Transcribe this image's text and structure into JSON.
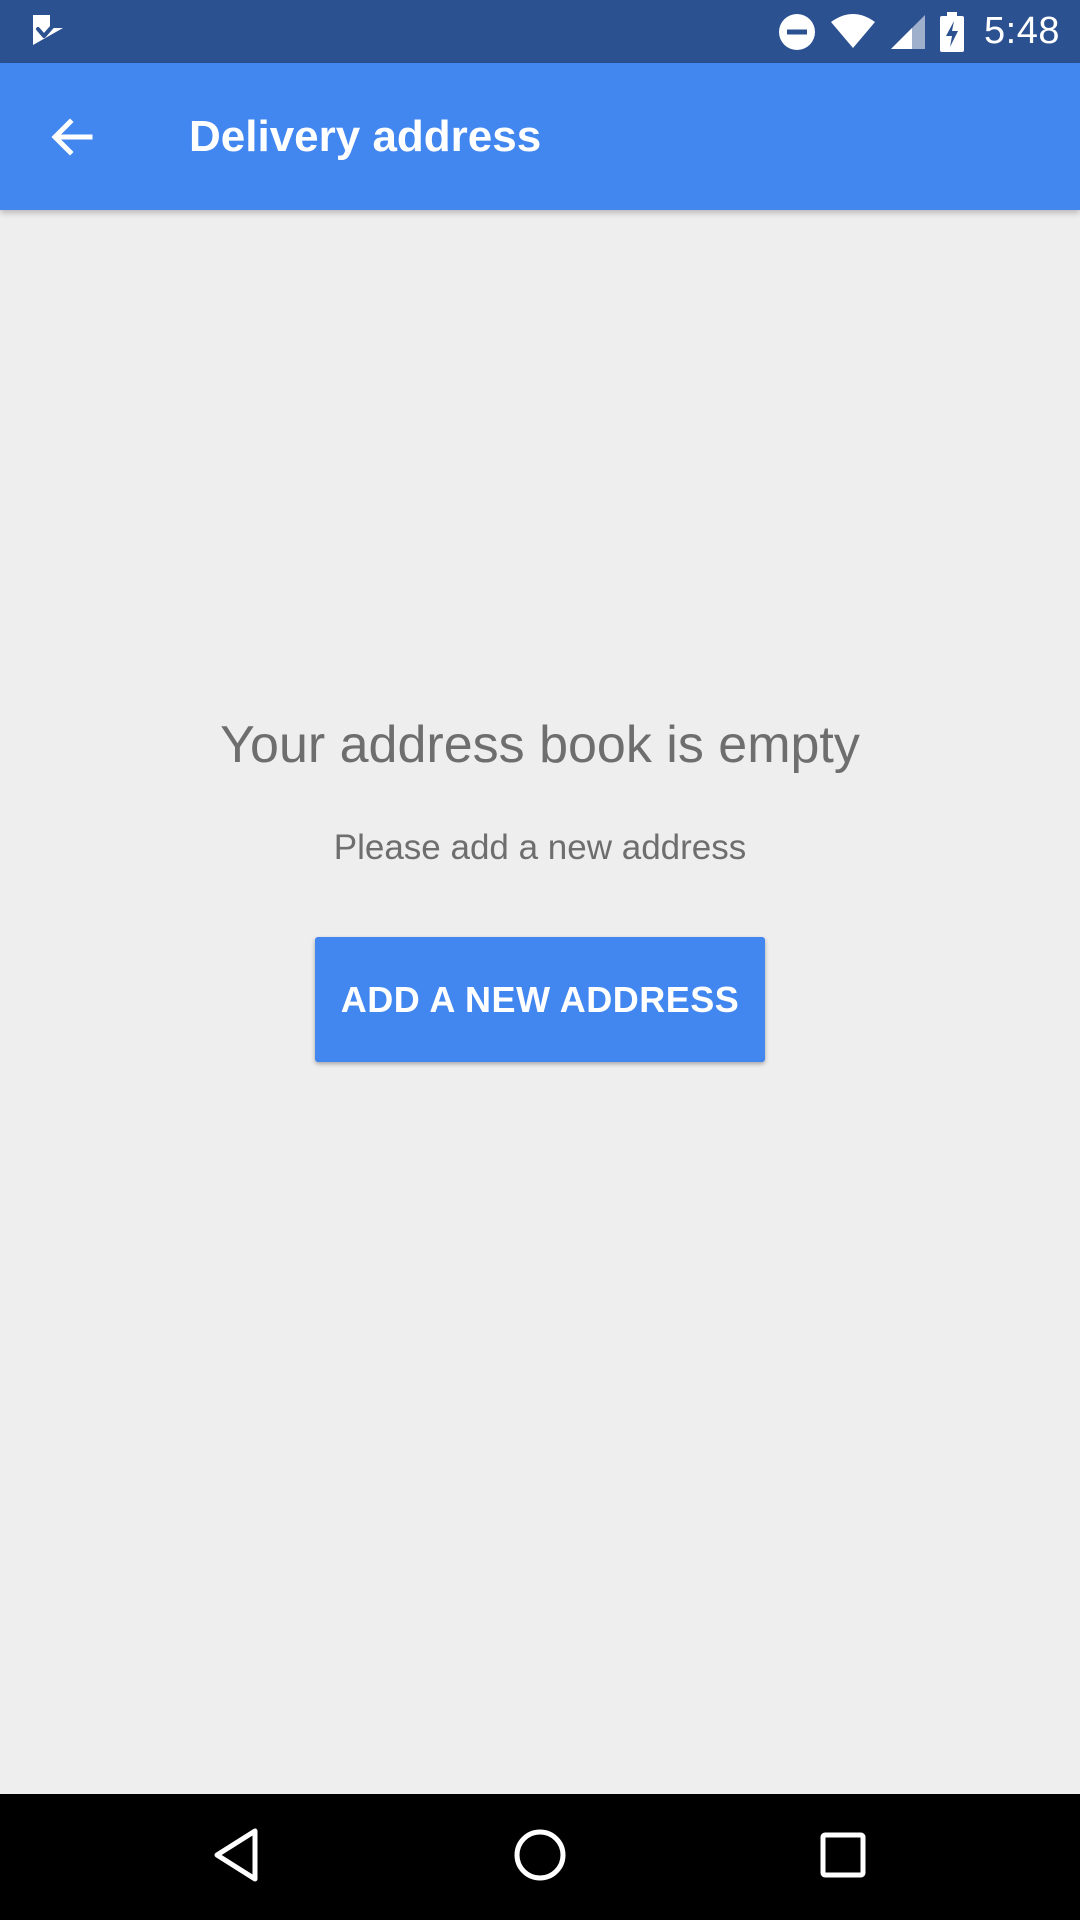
{
  "status_bar": {
    "time": "5:48",
    "icons": [
      "app-notification-icon",
      "do-not-disturb-icon",
      "wifi-icon",
      "cellular-signal-icon",
      "battery-charging-icon"
    ]
  },
  "app_bar": {
    "title": "Delivery address",
    "back_icon": "arrow-back-icon"
  },
  "empty_state": {
    "title": "Your address book is empty",
    "subtitle": "Please add a new address",
    "button_label": "ADD A NEW ADDRESS"
  },
  "nav_bar": {
    "icons": [
      "back-triangle-icon",
      "home-circle-icon",
      "recents-square-icon"
    ]
  },
  "colors": {
    "status_bar": "#2c5191",
    "app_bar": "#4287f0",
    "background": "#eeeeee",
    "text_secondary": "#6e6e6e",
    "button": "#4287f0"
  }
}
